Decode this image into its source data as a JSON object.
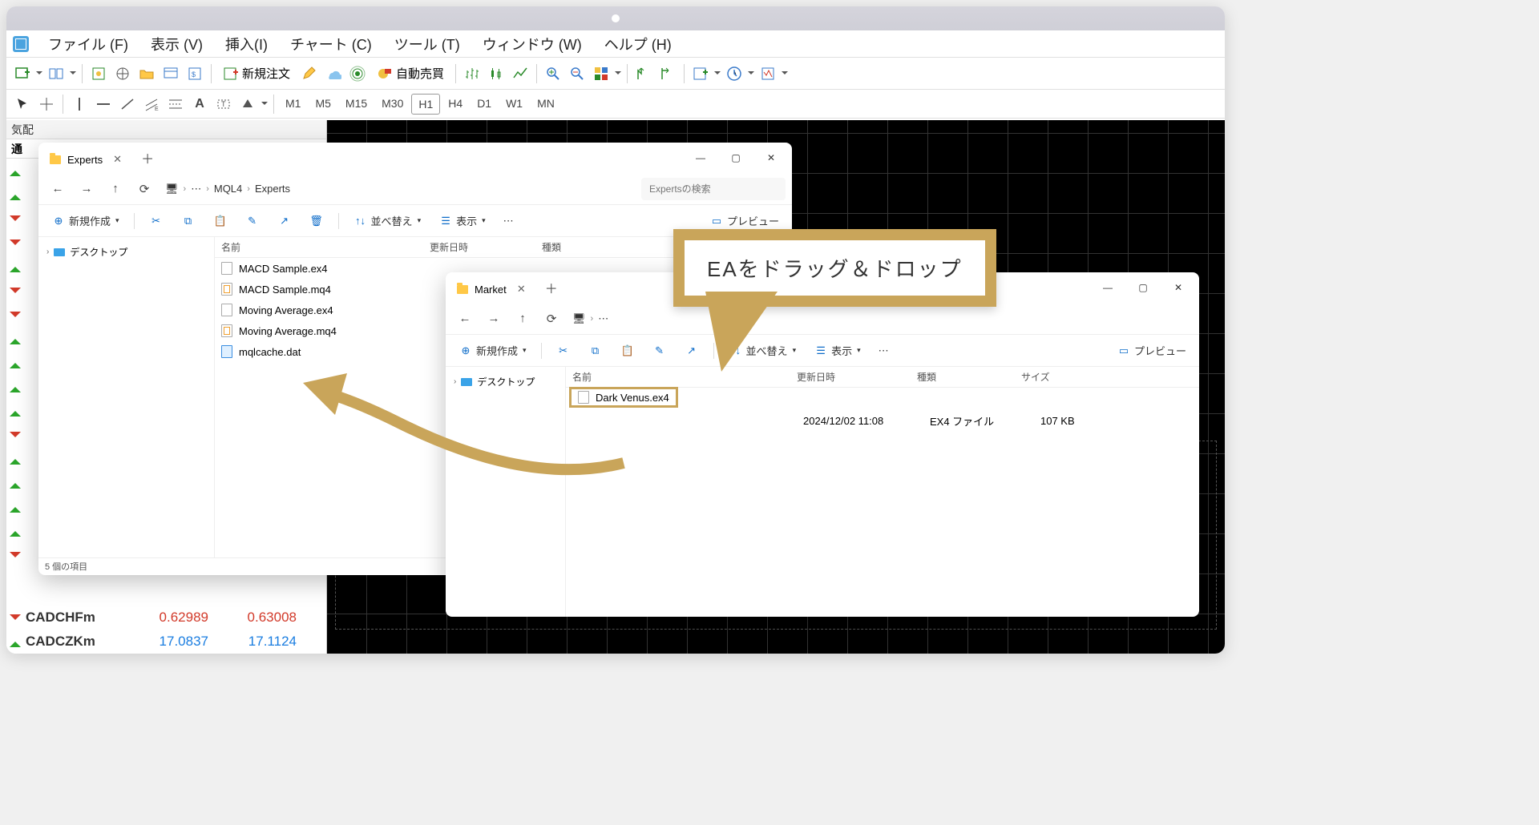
{
  "menu": {
    "file": "ファイル (F)",
    "view": "表示 (V)",
    "insert": "挿入(I)",
    "chart": "チャート (C)",
    "tools": "ツール (T)",
    "window": "ウィンドウ (W)",
    "help": "ヘルプ (H)"
  },
  "toolbar": {
    "new_order": "新規注文",
    "auto_trade": "自動売買"
  },
  "timeframes": [
    "M1",
    "M5",
    "M15",
    "M30",
    "H1",
    "H4",
    "D1",
    "W1",
    "MN"
  ],
  "active_tf": "H1",
  "market_watch": {
    "title": "気配",
    "col_sym": "通",
    "rows": [
      {
        "sym": "CADCHFm",
        "bid": "0.62989",
        "ask": "0.63008",
        "dir": "down",
        "cls": "down"
      },
      {
        "sym": "CADCZKm",
        "bid": "17.0837",
        "ask": "17.1124",
        "dir": "up",
        "cls": "up"
      }
    ],
    "arrows": [
      "up",
      "up",
      "down",
      "down",
      "up",
      "down",
      "down",
      "up",
      "up",
      "up",
      "up",
      "down",
      "up",
      "up",
      "up",
      "up",
      "down"
    ]
  },
  "explorer1": {
    "tab": "Experts",
    "bc": [
      "MQL4",
      "Experts"
    ],
    "search_ph": "Expertsの検索",
    "new": "新規作成",
    "sort": "並べ替え",
    "display": "表示",
    "preview": "プレビュー",
    "side_desktop": "デスクトップ",
    "col_name": "名前",
    "col_date": "更新日時",
    "col_type": "種類",
    "files": [
      {
        "name": "MACD Sample.ex4",
        "icon": "ex"
      },
      {
        "name": "MACD Sample.mq4",
        "icon": "mq"
      },
      {
        "name": "Moving Average.ex4",
        "icon": "ex"
      },
      {
        "name": "Moving Average.mq4",
        "icon": "mq"
      },
      {
        "name": "mqlcache.dat",
        "icon": "dat"
      }
    ],
    "status": "5 個の項目"
  },
  "explorer2": {
    "tab": "Market",
    "new": "新規作成",
    "sort": "並べ替え",
    "display": "表示",
    "preview": "プレビュー",
    "side_desktop": "デスクトップ",
    "col_name": "名前",
    "col_date": "更新日時",
    "col_type": "種類",
    "col_size": "サイズ",
    "file": {
      "name": "Dark Venus.ex4",
      "date": "2024/12/02 11:08",
      "type": "EX4 ファイル",
      "size": "107 KB"
    }
  },
  "callout": "EAをドラッグ＆ドロップ"
}
